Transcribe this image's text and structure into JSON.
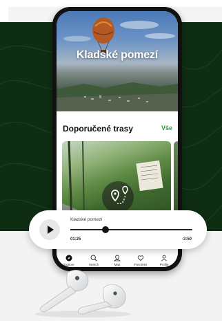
{
  "hero": {
    "title": "Kladské pomezí"
  },
  "section": {
    "title": "Doporučené trasy",
    "see_all": "Vše"
  },
  "player": {
    "track_title": "Kladské pomezí",
    "elapsed": "01:25",
    "remaining": "-3:50",
    "progress": 0.29
  },
  "tabs": [
    {
      "label": "Explore",
      "icon": "compass-icon"
    },
    {
      "label": "Search",
      "icon": "search-icon"
    },
    {
      "label": "Map",
      "icon": "map-icon"
    },
    {
      "label": "Favorites",
      "icon": "heart-icon"
    },
    {
      "label": "Profile",
      "icon": "profile-icon"
    }
  ],
  "colors": {
    "accent": "#27a13a",
    "background_green": "#0f2d13",
    "phone_frame": "#111111"
  }
}
